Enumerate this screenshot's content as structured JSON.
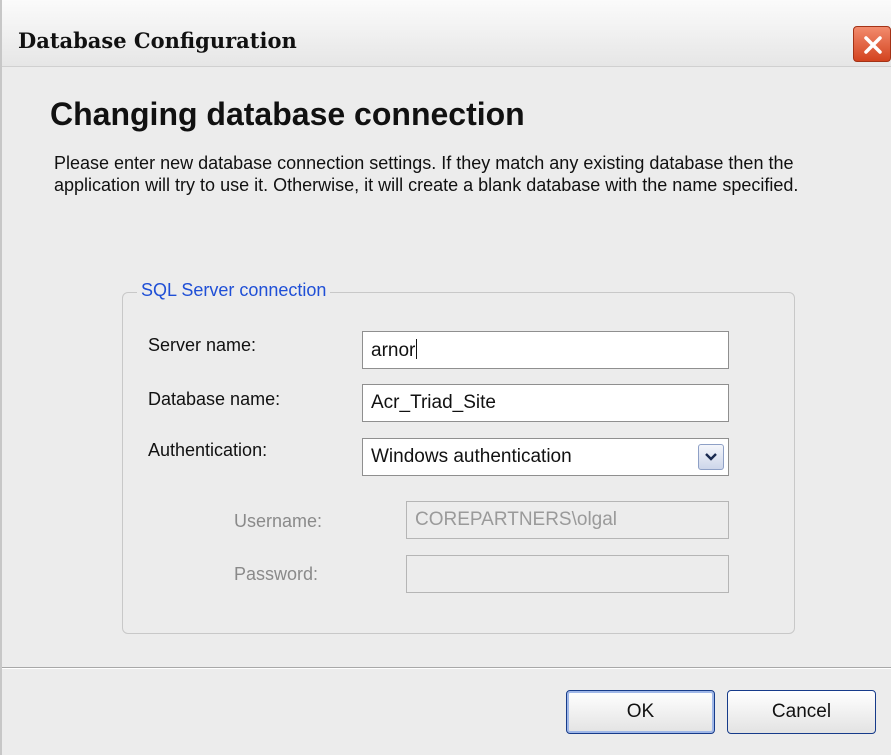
{
  "window": {
    "title": "Database Configuration",
    "close_icon": "close-icon"
  },
  "main": {
    "heading": "Changing database connection",
    "description": "Please enter new database connection settings. If they match any existing database then the application will try to use it. Otherwise, it will create a blank database with the name specified."
  },
  "group": {
    "legend": "SQL Server connection",
    "server_name_label": "Server name:",
    "server_name_value": "arnor",
    "database_name_label": "Database  name:",
    "database_name_value": "Acr_Triad_Site",
    "authentication_label": "Authentication:",
    "authentication_value": "Windows authentication",
    "username_label": "Username:",
    "username_value": "COREPARTNERS\\olgal",
    "password_label": "Password:",
    "password_value": ""
  },
  "buttons": {
    "ok": "OK",
    "cancel": "Cancel"
  },
  "colors": {
    "legend": "#1f4fd6",
    "close_button": "#d3431f"
  }
}
